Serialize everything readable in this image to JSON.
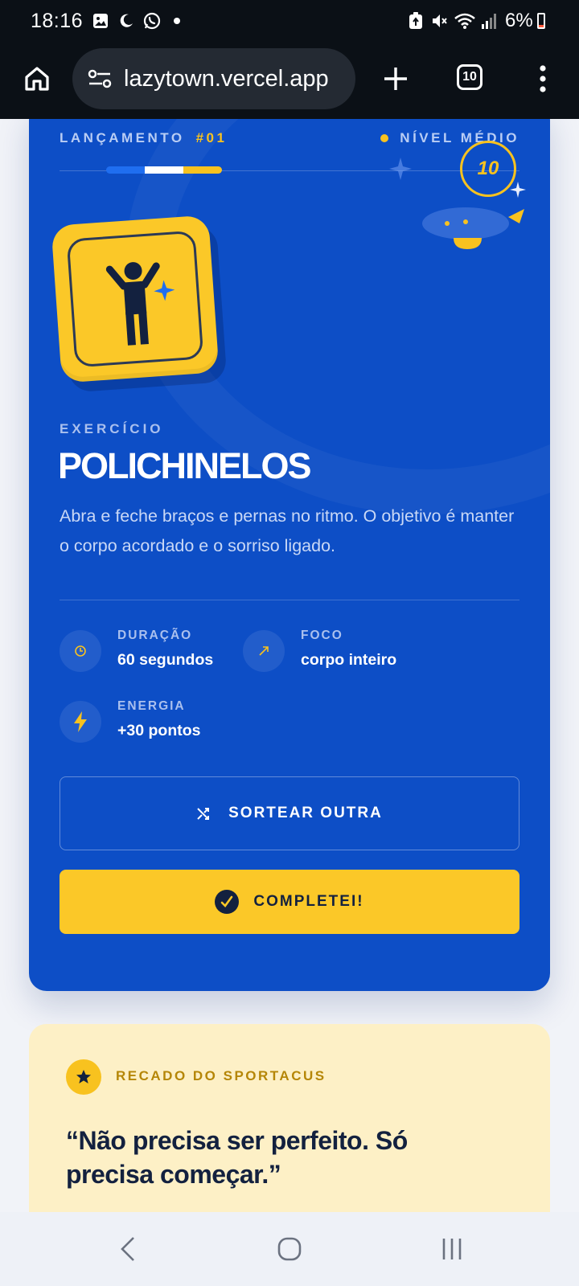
{
  "status_bar": {
    "time": "18:16",
    "battery": "6%",
    "icons": [
      "gallery-icon",
      "moon-icon",
      "whatsapp-icon",
      "dot-icon",
      "recycle-icon",
      "mute-icon",
      "wifi-icon",
      "signal-icon"
    ]
  },
  "browser": {
    "url": "lazytown.vercel.app",
    "tab_count": "10",
    "icons": [
      "home-icon",
      "site-info-icon",
      "plus-icon",
      "more-vert-icon"
    ]
  },
  "card": {
    "launch_label": "LANÇAMENTO",
    "launch_number": "#01",
    "level": "NÍVEL MÉDIO",
    "coin_value": "10",
    "progress_colors": [
      "#1f6ef0",
      "#ffffff",
      "#f8c21f"
    ],
    "exercise_label": "EXERCÍCIO",
    "exercise_title": "POLICHINELOS",
    "exercise_description": "Abra e feche braços e pernas no ritmo. O objetivo é manter o corpo acordado e o sorriso ligado.",
    "stats": {
      "duration": {
        "label": "DURAÇÃO",
        "value": "60 segundos",
        "icon": "clock-icon"
      },
      "focus": {
        "label": "FOCO",
        "value": "corpo inteiro",
        "icon": "arrow-up-right-icon"
      },
      "energy": {
        "label": "ENERGIA",
        "value": "+30 pontos",
        "icon": "lightning-icon"
      }
    },
    "shuffle_button": "SORTEAR OUTRA",
    "complete_button": "COMPLETEI!",
    "colors": {
      "card": "#0d4ec6",
      "accent": "#f8c21f",
      "dark": "#13213f"
    }
  },
  "note": {
    "label": "RECADO DO SPORTACUS",
    "quote": "“Não precisa ser perfeito. Só precisa começar.”",
    "icon": "star-icon",
    "background": "#fdf0c6"
  },
  "nav_bar": {
    "icons": [
      "back-icon",
      "home-circle-icon",
      "recents-icon"
    ]
  }
}
